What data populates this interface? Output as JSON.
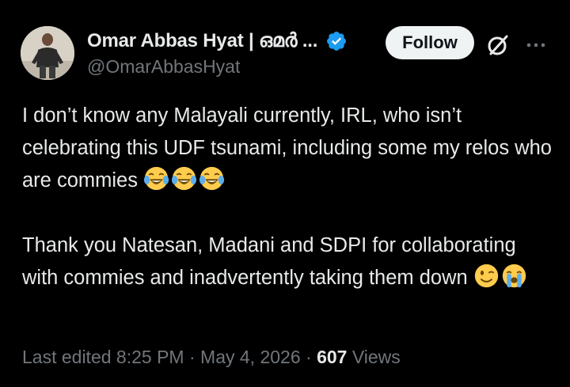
{
  "author": {
    "display_name": "Omar Abbas Hyat | ഒമർ ...",
    "handle": "@OmarAbbasHyat",
    "verified": true
  },
  "actions": {
    "follow_label": "Follow",
    "grok_icon": "grok-icon",
    "more_icon": "more-icon"
  },
  "tweet": {
    "paragraph_1_text": "I don’t know any Malayali currently, IRL, who isn’t celebrating this UDF tsunami, including some my relos who are commies",
    "paragraph_1_emojis": [
      "tears-of-joy-emoji",
      "tears-of-joy-emoji",
      "tears-of-joy-emoji"
    ],
    "paragraph_2_text": "Thank you Natesan, Madani and SDPI for collaborating with commies and inadvertently taking them down",
    "paragraph_2_emojis": [
      "winking-face-emoji",
      "loudly-crying-emoji"
    ]
  },
  "meta": {
    "edited_label": "Last edited",
    "time": "8:25 PM",
    "separator": "·",
    "date": "May 4, 2026",
    "views_count": "607",
    "views_label": "Views"
  },
  "colors": {
    "background": "#000000",
    "text_primary": "#e7e9ea",
    "text_secondary": "#71767b",
    "verified_blue": "#1d9bf0",
    "follow_bg": "#eff3f4",
    "follow_text": "#0f1419"
  }
}
